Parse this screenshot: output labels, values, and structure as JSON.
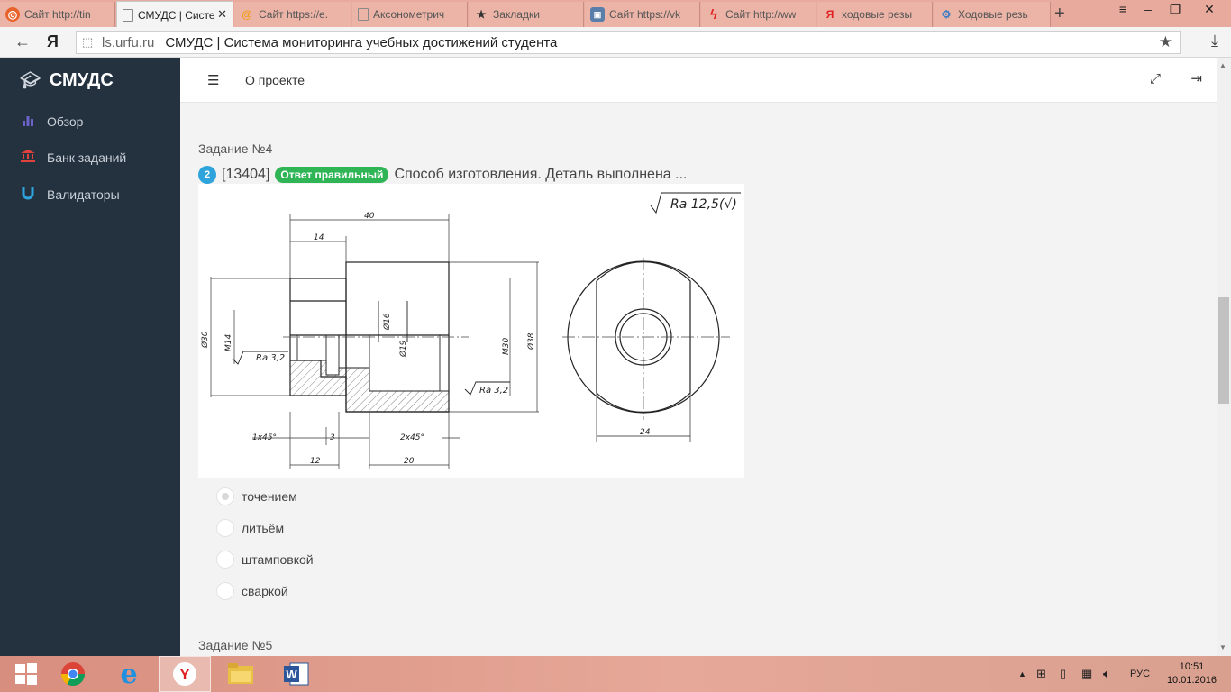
{
  "browser": {
    "tabs": [
      {
        "label": "Сайт http://tin",
        "icon": "tin-icon",
        "active": false
      },
      {
        "label": "СМУДС | Систе",
        "icon": "page-icon",
        "active": true
      },
      {
        "label": "Сайт https://e.",
        "icon": "mail-icon",
        "active": false
      },
      {
        "label": "Аксонометрич",
        "icon": "page-icon",
        "active": false
      },
      {
        "label": "Закладки",
        "icon": "star-icon",
        "active": false
      },
      {
        "label": "Сайт https://vk",
        "icon": "vk-icon",
        "active": false
      },
      {
        "label": "Сайт http://ww",
        "icon": "bolt-icon",
        "active": false
      },
      {
        "label": "ходовые резы",
        "icon": "yandex-icon",
        "active": false
      },
      {
        "label": "Ходовые резь",
        "icon": "gear-icon",
        "active": false
      }
    ],
    "address": {
      "domain": "ls.urfu.ru",
      "page_title": "СМУДС | Система мониторинга учебных достижений студента"
    },
    "yandex_glyph": "Я"
  },
  "sidebar": {
    "brand": "СМУДС",
    "items": [
      {
        "label": "Обзор",
        "icon": "bar-chart-icon",
        "color": "#6b63c9"
      },
      {
        "label": "Банк заданий",
        "icon": "bank-icon",
        "color": "#e0433c"
      },
      {
        "label": "Валидаторы",
        "icon": "magnet-icon",
        "color": "#2fa4dc"
      }
    ]
  },
  "topbar": {
    "about": "О проекте"
  },
  "task4": {
    "heading": "Задание №4",
    "badge_num": "2",
    "id": "[13404]",
    "status": "Ответ правильный",
    "question": "Способ изготовления. Деталь выполнена ...",
    "options": [
      {
        "label": "точением",
        "checked": true
      },
      {
        "label": "литьём",
        "checked": false
      },
      {
        "label": "штамповкой",
        "checked": false
      },
      {
        "label": "сваркой",
        "checked": false
      }
    ]
  },
  "task5": {
    "heading": "Задание №5"
  },
  "drawing": {
    "ra_main": "Ra 12,5",
    "ra_local": "Ra 3,2",
    "dims": {
      "d40": "40",
      "d14": "14",
      "d30": "Ø30",
      "m14": "M14",
      "d16": "Ø16",
      "d19": "Ø19",
      "m30": "M30",
      "d38": "Ø38",
      "ch1": "1x45°",
      "d3": "3",
      "ch2": "2x45°",
      "d12": "12",
      "d20": "20",
      "d24": "24"
    }
  },
  "taskbar": {
    "lang": "РУС",
    "time": "10:51",
    "date": "10.01.2016"
  },
  "colors": {
    "sidebar_bg": "#24313f",
    "badge_ok": "#2fb456",
    "badge_num": "#2fa4dc",
    "tabstrip": "#e8aa9c"
  }
}
